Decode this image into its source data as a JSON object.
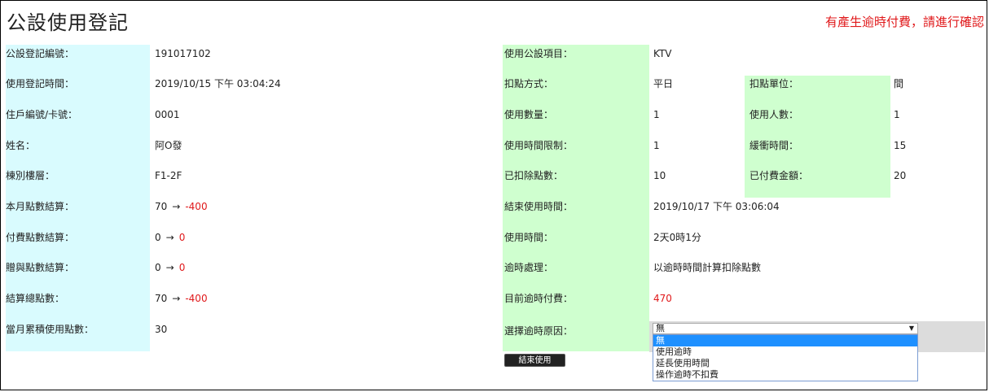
{
  "page": {
    "title": "公設使用登記",
    "notice": "有產生逾時付費，請進行確認"
  },
  "left": {
    "rows": [
      {
        "label": "公設登記編號：",
        "value": "191017102"
      },
      {
        "label": "使用登記時間：",
        "value": "2019/10/15 下午 03:04:24"
      },
      {
        "label": "住戶編號/卡號：",
        "value": "0001"
      },
      {
        "label": "姓名：",
        "value": "阿O發"
      },
      {
        "label": "棟別樓層：",
        "value": "F1-2F"
      },
      {
        "label": "本月點數結算：",
        "from": "70",
        "arrow": "→",
        "to": "-400"
      },
      {
        "label": "付費點數結算：",
        "from": "0",
        "arrow": "→",
        "to": "0"
      },
      {
        "label": "贈與點數結算：",
        "from": "0",
        "arrow": "→",
        "to": "0"
      },
      {
        "label": "結算總點數：",
        "from": "70",
        "arrow": "→",
        "to": "-400"
      },
      {
        "label": "當月累積使用點數：",
        "value": "30"
      }
    ]
  },
  "right": {
    "rows": [
      {
        "label": "使用公設項目：",
        "value": "KTV"
      },
      {
        "label": "扣點方式：",
        "value": "平日",
        "label2": "扣點單位：",
        "value2": "間"
      },
      {
        "label": "使用數量：",
        "value": "1",
        "label2": "使用人數：",
        "value2": "1"
      },
      {
        "label": "使用時間限制：",
        "value": "1",
        "label2": "緩衝時間：",
        "value2": "15"
      },
      {
        "label": "已扣除點數：",
        "value": "10",
        "label2": "已付費金額：",
        "value2": "20"
      },
      {
        "label": "結束使用時間：",
        "value": "2019/10/17 下午 03:06:04"
      },
      {
        "label": "使用時間：",
        "value": "2天0時1分"
      },
      {
        "label": "逾時處理：",
        "value": "以逾時時間計算扣除點數"
      },
      {
        "label": "目前逾時付費：",
        "value": "470"
      },
      {
        "label": "選擇逾時原因："
      }
    ]
  },
  "overtime_reason": {
    "selected": "無",
    "options": [
      "無",
      "使用逾時",
      "延長使用時間",
      "操作逾時不扣費"
    ]
  },
  "actions": {
    "end_use_label": "結束使用"
  },
  "colors": {
    "cyan_label_bg": "#d9fbfe",
    "green_label_bg": "#cfffcf",
    "alert_red": "#e0191b",
    "dropdown_highlight": "#1e90ff"
  }
}
